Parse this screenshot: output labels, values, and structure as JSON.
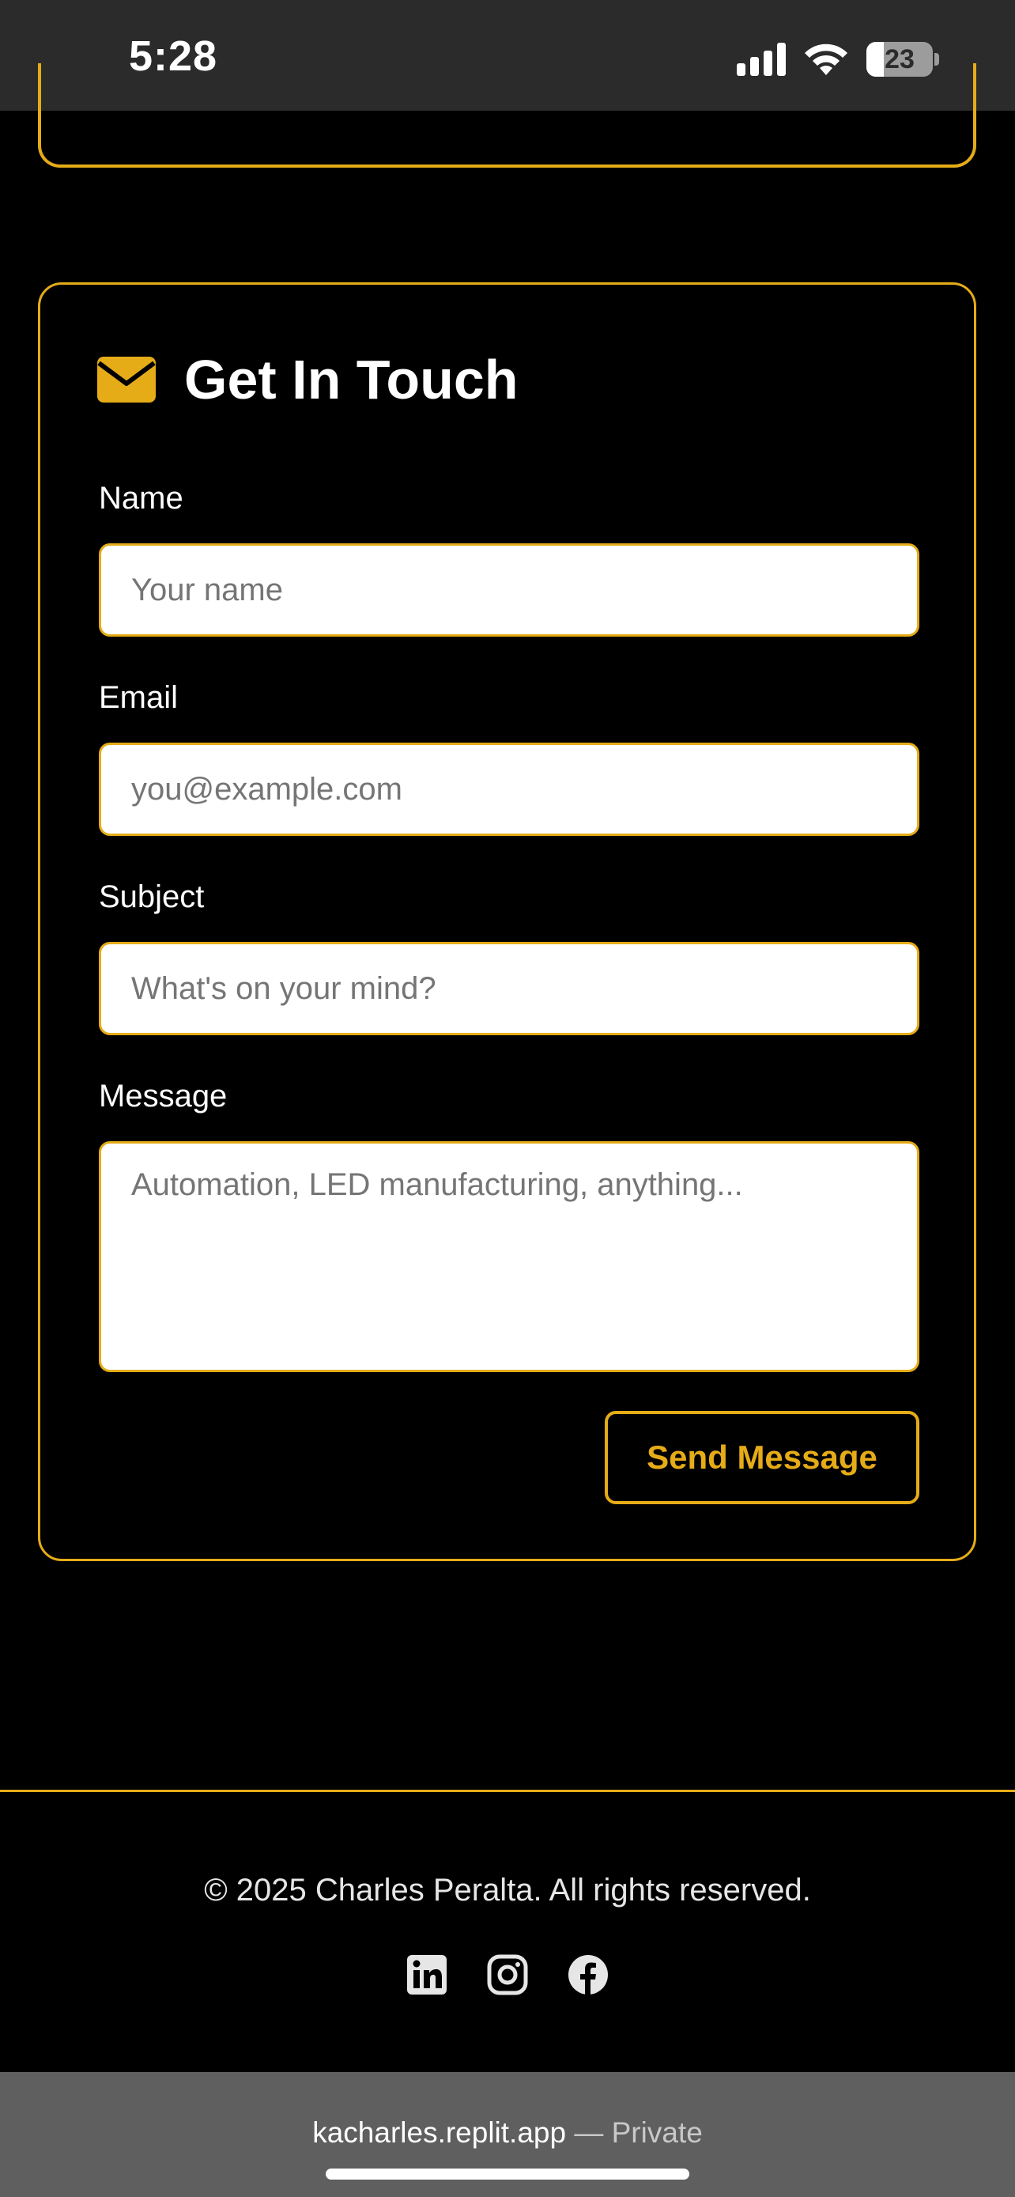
{
  "status_bar": {
    "time": "5:28",
    "battery_level": "23"
  },
  "contact": {
    "title": "Get In Touch",
    "fields": {
      "name": {
        "label": "Name",
        "placeholder": "Your name",
        "value": ""
      },
      "email": {
        "label": "Email",
        "placeholder": "you@example.com",
        "value": ""
      },
      "subject": {
        "label": "Subject",
        "placeholder": "What's on your mind?",
        "value": ""
      },
      "message": {
        "label": "Message",
        "placeholder": "Automation, LED manufacturing, anything...",
        "value": ""
      }
    },
    "submit_label": "Send Message"
  },
  "footer": {
    "copyright": "© 2025 Charles Peralta. All rights reserved.",
    "social": [
      "linkedin-icon",
      "instagram-icon",
      "facebook-icon"
    ]
  },
  "browser": {
    "domain": "kacharles.replit.app",
    "separator": "—",
    "privacy": "Private"
  },
  "colors": {
    "accent": "#e5ac18",
    "background": "#000000",
    "status_bar": "#2b2b2b",
    "browser_bar": "#5f5f5f"
  }
}
